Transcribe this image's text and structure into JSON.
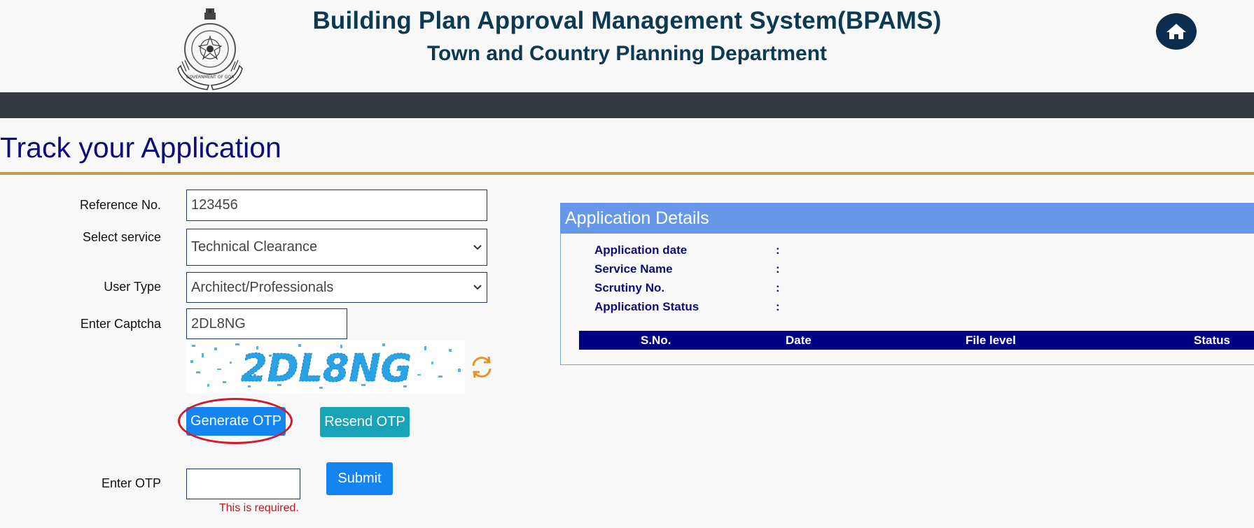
{
  "header": {
    "title": "Building Plan Approval Management System(BPAMS)",
    "subtitle": "Town and Country Planning Department",
    "emblem_text": "GOVERNMENT OF GOA"
  },
  "page": {
    "title": "Track your Application"
  },
  "form": {
    "reference_label": "Reference No.",
    "reference_value": "123456",
    "service_label": "Select service",
    "service_value": "Technical Clearance",
    "user_type_label": "User Type",
    "user_type_value": "Architect/Professionals",
    "captcha_label": "Enter Captcha",
    "captcha_value": "2DL8NG",
    "captcha_image_text": "2DL8NG",
    "generate_otp_label": "Generate OTP",
    "resend_otp_label": "Resend OTP",
    "otp_label": "Enter OTP",
    "otp_value": "",
    "submit_label": "Submit",
    "otp_error": "This is required."
  },
  "details": {
    "header": "Application Details",
    "fields": [
      {
        "label": "Application date",
        "value": ":"
      },
      {
        "label": "Service Name",
        "value": ":"
      },
      {
        "label": "Scrutiny No.",
        "value": ":"
      },
      {
        "label": "Application Status",
        "value": ":"
      }
    ],
    "table_headers": [
      "S.No.",
      "Date",
      "File level",
      "Status"
    ]
  },
  "colors": {
    "navbar": "#343a40",
    "primary_button": "#1384f0",
    "resend_button": "#18a3b8",
    "details_header": "#6797e9",
    "table_header": "#020284",
    "title_color": "#0e0e7a",
    "accent_rule": "#c79a54",
    "highlight_ring": "#d11b2b"
  }
}
